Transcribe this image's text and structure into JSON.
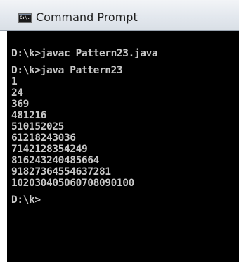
{
  "window": {
    "title": "Command Prompt",
    "icon": "cmd-icon",
    "icon_text": "C:\\."
  },
  "console": {
    "lines": [
      "D:\\k>javac Pattern23.java",
      "",
      "D:\\k>java Pattern23",
      "1",
      "24",
      "369",
      "481216",
      "510152025",
      "61218243036",
      "7142128354249",
      "816243240485664",
      "91827364554637281",
      "102030405060708090100",
      "",
      "D:\\k>"
    ]
  },
  "colors": {
    "console_background": "#000000",
    "console_text": "#c8c8c8",
    "titlebar": "#e3e8ee"
  }
}
